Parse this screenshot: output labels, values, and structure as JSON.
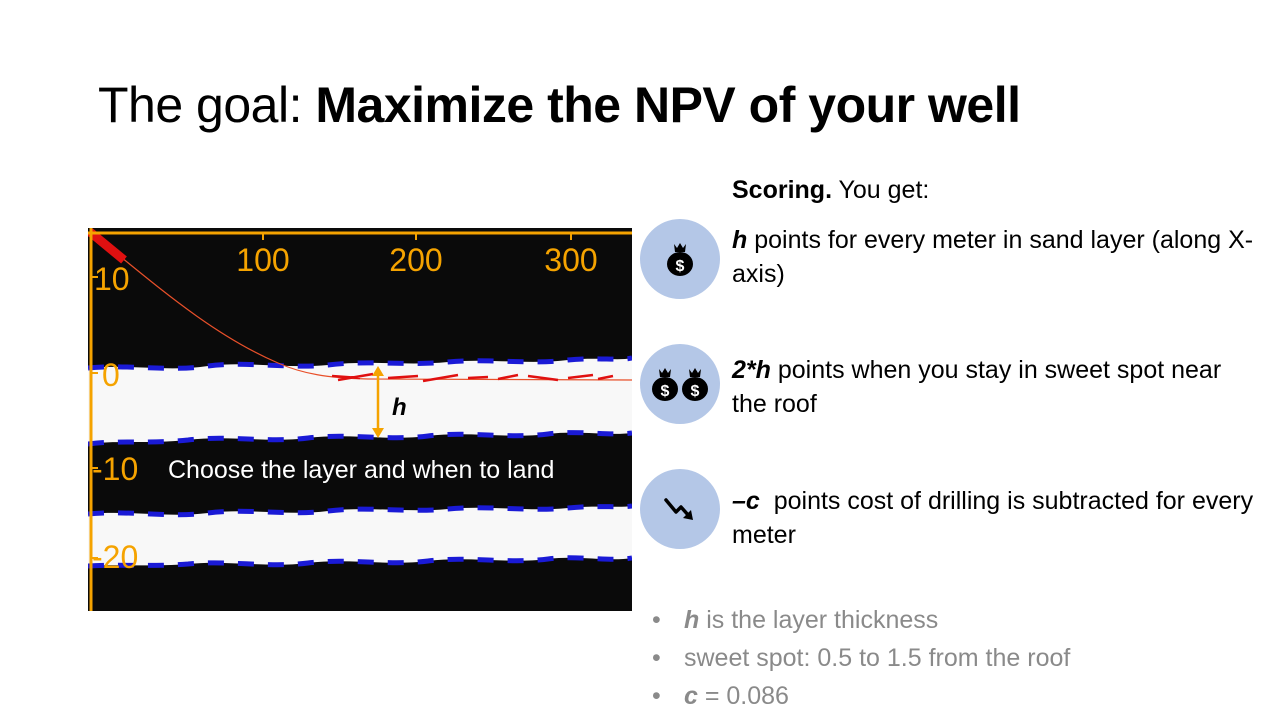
{
  "title": {
    "prefix": "The goal: ",
    "bold": "Maximize the NPV of your well"
  },
  "plot": {
    "x_ticks": [
      "100",
      "200",
      "300"
    ],
    "y_ticks": [
      "10",
      "0",
      "-10",
      "-20"
    ],
    "h_label": "h",
    "caption": "Choose the layer and when to land",
    "colors": {
      "background": "#0a0a0a",
      "sand": "#f8f8f8",
      "boundary": "#1a1ad6",
      "axis": "#f5a300",
      "well": "#e01010"
    }
  },
  "scoring": {
    "heading_bold": "Scoring.",
    "heading_rest": " You get:",
    "items": [
      {
        "icon": "money-bag-icon",
        "keyword": "h",
        "text": " points for every meter in sand layer (along X-axis)"
      },
      {
        "icon": "two-money-bags-icon",
        "keyword": "2*h",
        "text": " points when you stay in sweet spot near the roof"
      },
      {
        "icon": "trend-down-icon",
        "keyword": "–c",
        "text": "  points cost of drilling is subtracted for every meter"
      }
    ]
  },
  "notes": [
    {
      "keyword": "h",
      "text": " is the layer thickness"
    },
    {
      "keyword": "",
      "text": "sweet spot: 0.5 to 1.5 from the roof"
    },
    {
      "keyword": "c",
      "text": " = 0.086"
    }
  ]
}
